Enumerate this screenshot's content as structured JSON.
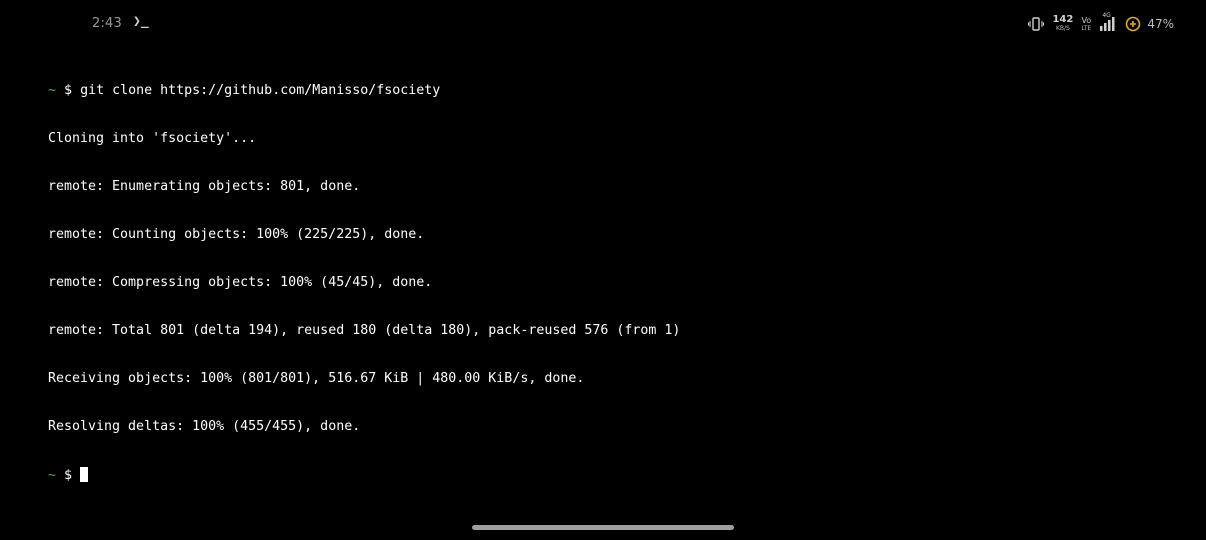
{
  "status_bar": {
    "time": "2:43",
    "app_icon": "terminal-prompt-icon",
    "app_icon_glyph": "❯_",
    "net_speed_value": "142",
    "net_speed_unit": "KB/S",
    "volte_top": "Vo",
    "volte_bottom": "LTE",
    "network_type": "4G",
    "battery_percent": "47%",
    "icons": [
      "vibrate-icon",
      "signal-icon",
      "battery-saver-icon"
    ]
  },
  "terminal": {
    "prompt_path": "~",
    "prompt_symbol": "$",
    "command": "git clone https://github.com/Manisso/fsociety",
    "output_lines": [
      "Cloning into 'fsociety'...",
      "remote: Enumerating objects: 801, done.",
      "remote: Counting objects: 100% (225/225), done.",
      "remote: Compressing objects: 100% (45/45), done.",
      "remote: Total 801 (delta 194), reused 180 (delta 180), pack-reused 576 (from 1)",
      "Receiving objects: 100% (801/801), 516.67 KiB | 480.00 KiB/s, done.",
      "Resolving deltas: 100% (455/455), done."
    ]
  },
  "colors": {
    "background": "#000000",
    "text": "#ffffff",
    "prompt_tilde": "#4caf50",
    "status_text": "#9a9a9a",
    "home_indicator": "#9e9e9e"
  }
}
